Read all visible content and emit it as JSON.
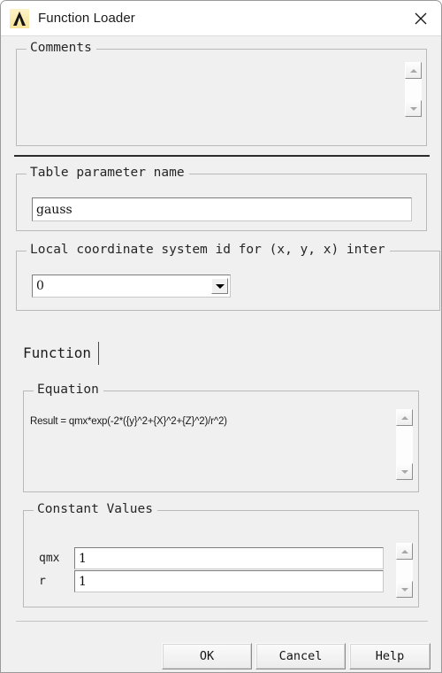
{
  "window": {
    "title": "Function Loader",
    "app_icon": "lambda-icon",
    "close_icon": "close-icon"
  },
  "comments": {
    "legend": "Comments",
    "value": "",
    "scroll_up_icon": "scroll-up-icon",
    "scroll_down_icon": "scroll-down-icon"
  },
  "table_parameter": {
    "legend": "Table parameter name",
    "value": "gauss",
    "placeholder": ""
  },
  "local_coordinate": {
    "legend": "Local coordinate system id for (x, y, x) inter",
    "selected": "0",
    "options": [
      "0"
    ],
    "dropdown_icon": "chevron-down-icon"
  },
  "tabs": [
    {
      "label": "Function",
      "active": true
    }
  ],
  "equation": {
    "legend": "Equation",
    "text": "Result = qmx*exp(-2*({y}^2+{X}^2+{Z}^2)/r^2)",
    "scroll_up_icon": "scroll-up-icon",
    "scroll_down_icon": "scroll-down-icon"
  },
  "constants": {
    "legend": "Constant Values",
    "rows": [
      {
        "name": "qmx",
        "value": "1"
      },
      {
        "name": "r",
        "value": "1"
      }
    ],
    "scroll_up_icon": "scroll-up-icon",
    "scroll_down_icon": "scroll-down-icon"
  },
  "footer": {
    "ok": "OK",
    "cancel": "Cancel",
    "help": "Help"
  },
  "colors": {
    "window_bg": "#f0f0f0",
    "titlebar_bg": "#ffffff",
    "field_bg": "#ffffff",
    "border": "#b9b9b9",
    "icon_bg": "#f6e49a",
    "text": "#1b1b1b"
  }
}
